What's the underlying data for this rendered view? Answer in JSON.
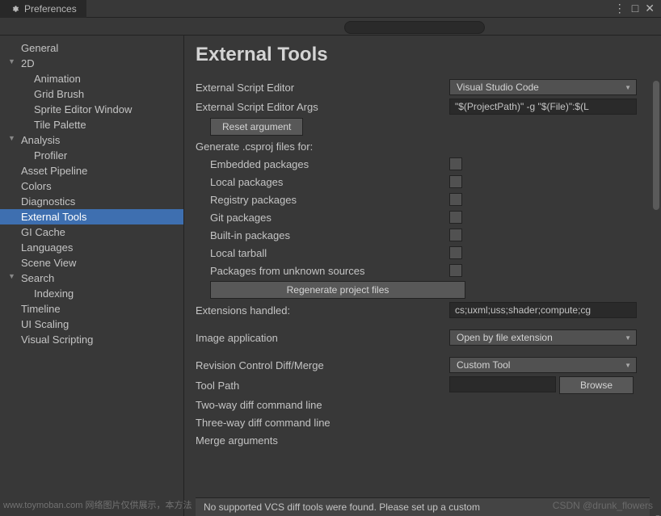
{
  "window": {
    "title": "Preferences"
  },
  "sidebar": {
    "items": [
      {
        "label": "General",
        "level": 1
      },
      {
        "label": "2D",
        "level": 1,
        "children": true
      },
      {
        "label": "Animation",
        "level": 2
      },
      {
        "label": "Grid Brush",
        "level": 2
      },
      {
        "label": "Sprite Editor Window",
        "level": 2
      },
      {
        "label": "Tile Palette",
        "level": 2
      },
      {
        "label": "Analysis",
        "level": 1,
        "children": true
      },
      {
        "label": "Profiler",
        "level": 2
      },
      {
        "label": "Asset Pipeline",
        "level": 1
      },
      {
        "label": "Colors",
        "level": 1
      },
      {
        "label": "Diagnostics",
        "level": 1
      },
      {
        "label": "External Tools",
        "level": 1,
        "selected": true
      },
      {
        "label": "GI Cache",
        "level": 1
      },
      {
        "label": "Languages",
        "level": 1
      },
      {
        "label": "Scene View",
        "level": 1
      },
      {
        "label": "Search",
        "level": 1,
        "children": true
      },
      {
        "label": "Indexing",
        "level": 2
      },
      {
        "label": "Timeline",
        "level": 1
      },
      {
        "label": "UI Scaling",
        "level": 1
      },
      {
        "label": "Visual Scripting",
        "level": 1
      }
    ]
  },
  "content": {
    "title": "External Tools",
    "labels": {
      "scriptEditor": "External Script Editor",
      "scriptEditorArgs": "External Script Editor Args",
      "resetArg": "Reset argument",
      "generateFor": "Generate .csproj files for:",
      "embedded": "Embedded packages",
      "local": "Local packages",
      "registry": "Registry packages",
      "git": "Git packages",
      "builtin": "Built-in packages",
      "tarball": "Local tarball",
      "unknown": "Packages from unknown sources",
      "regenerate": "Regenerate project files",
      "extHandled": "Extensions handled:",
      "imageApp": "Image application",
      "revControl": "Revision Control Diff/Merge",
      "toolPath": "Tool Path",
      "browse": "Browse",
      "twoWay": "Two-way diff command line",
      "threeWay": "Three-way diff command line",
      "mergeArgs": "Merge arguments"
    },
    "values": {
      "scriptEditor": "Visual Studio Code",
      "scriptEditorArgs": "\"$(ProjectPath)\" -g \"$(File)\":$(L",
      "extHandled": "cs;uxml;uss;shader;compute;cg",
      "imageApp": "Open by file extension",
      "revControl": "Custom Tool",
      "toolPath": ""
    },
    "footer": "No supported VCS diff tools were found. Please set up a custom"
  },
  "watermark": "CSDN @drunk_flowers",
  "watermark2": "www.toymoban.com 网络图片仅供展示，本方法"
}
